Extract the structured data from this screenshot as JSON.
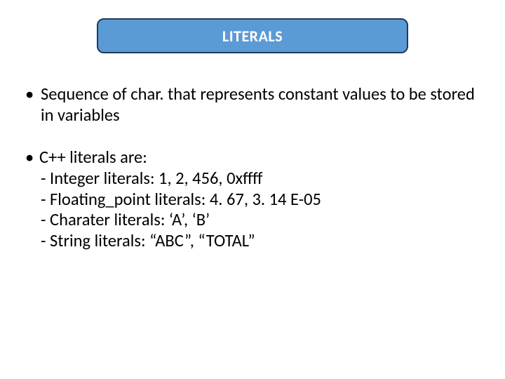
{
  "title": "LITERALS",
  "body": {
    "intro": "Sequence of char. that represents constant values to be stored in variables",
    "cpp_label": "C++ literals are:",
    "lines": [
      "- Integer literals: 1, 2, 456, 0xffff",
      "- Floating_point literals: 4. 67, 3. 14 E-05",
      "- Charater literals: ‘A’, ‘B’",
      "- String literals: “ABC”, “TOTAL”"
    ]
  }
}
